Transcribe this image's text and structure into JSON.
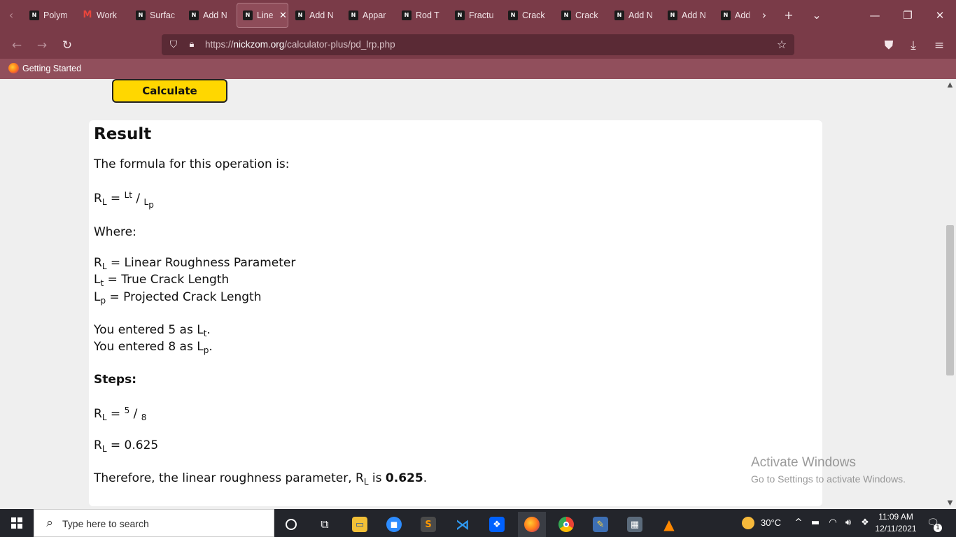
{
  "browser": {
    "tabs": [
      {
        "label": "Polym",
        "favicon": "nickzom-favicon"
      },
      {
        "label": "Work",
        "favicon": "gmail-favicon"
      },
      {
        "label": "Surfac",
        "favicon": "nickzom-favicon"
      },
      {
        "label": "Add N",
        "favicon": "nickzom-favicon"
      },
      {
        "label": "Line",
        "favicon": "nickzom-favicon",
        "active": true
      },
      {
        "label": "Add N",
        "favicon": "nickzom-favicon"
      },
      {
        "label": "Appar",
        "favicon": "nickzom-favicon"
      },
      {
        "label": "Rod T",
        "favicon": "nickzom-favicon"
      },
      {
        "label": "Fractu",
        "favicon": "nickzom-favicon"
      },
      {
        "label": "Crack",
        "favicon": "nickzom-favicon"
      },
      {
        "label": "Crack",
        "favicon": "nickzom-favicon"
      },
      {
        "label": "Add N",
        "favicon": "nickzom-favicon"
      },
      {
        "label": "Add N",
        "favicon": "nickzom-favicon"
      },
      {
        "label": "Add",
        "favicon": "nickzom-favicon"
      }
    ],
    "url_prefix": "https://",
    "url_host": "nickzom.org",
    "url_path": "/calculator-plus/pd_lrp.php",
    "bookmark": "Getting Started",
    "accent_color": "#7a3b48"
  },
  "page": {
    "calculate_label": "Calculate",
    "result_title": "Result",
    "formula_intro": "The formula for this operation is:",
    "formula": {
      "lhs": "R",
      "lhs_sub": "L",
      "num": "Lt",
      "den": "L",
      "den_sub": "p"
    },
    "where_label": "Where:",
    "definitions": [
      {
        "sym": "R",
        "sub": "L",
        "text": " = Linear Roughness Parameter"
      },
      {
        "sym": "L",
        "sub": "t",
        "text": " = True Crack Length"
      },
      {
        "sym": "L",
        "sub": "p",
        "text": " = Projected Crack Length"
      }
    ],
    "entered": [
      {
        "prefix": "You entered 5 as L",
        "sub": "t",
        "suffix": "."
      },
      {
        "prefix": "You entered 8 as L",
        "sub": "p",
        "suffix": "."
      }
    ],
    "steps_label": "Steps:",
    "step1": {
      "lhs": "R",
      "lhs_sub": "L",
      "num": "5",
      "den": "8"
    },
    "step2": {
      "lhs": "R",
      "lhs_sub": "L",
      "value": " = 0.625"
    },
    "conclusion": {
      "prefix": "Therefore, the linear roughness parameter, R",
      "sub": "L",
      "mid": " is ",
      "value": "0.625",
      "suffix": "."
    },
    "calc_button_color": "#ffd700"
  },
  "watermark": {
    "line1": "Activate Windows",
    "line2": "Go to Settings to activate Windows."
  },
  "taskbar": {
    "search_placeholder": "Type here to search",
    "weather": "30°C",
    "time": "11:09 AM",
    "date": "12/11/2021",
    "notification_count": "1"
  }
}
